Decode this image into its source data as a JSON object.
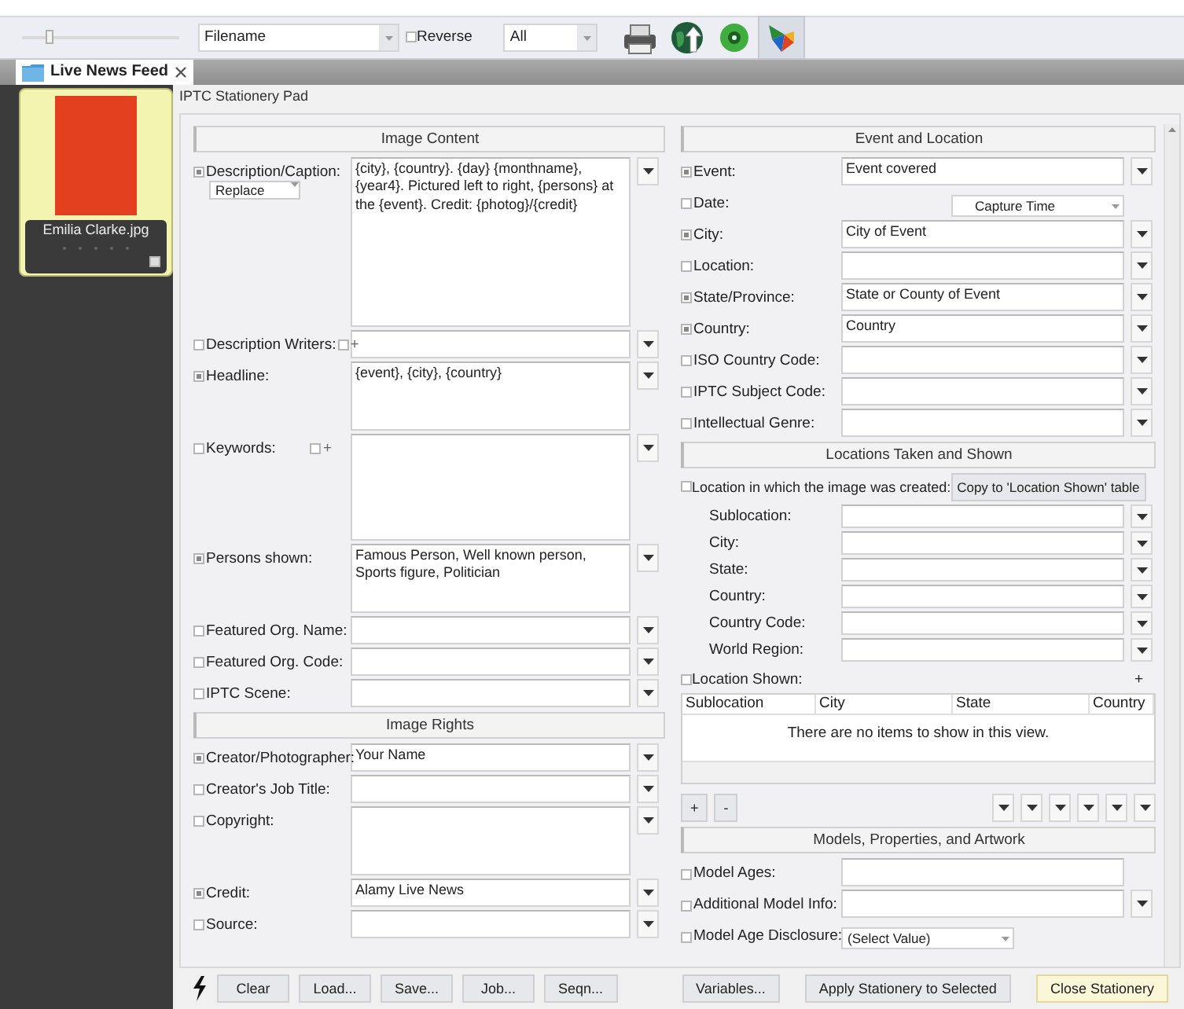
{
  "toolbar": {
    "zoom_slider": {
      "level": 0.15
    },
    "sort_field": {
      "value": "Filename"
    },
    "reverse": {
      "label": "Reverse",
      "checked": false
    },
    "filter": {
      "value": "All"
    },
    "tools": [
      {
        "kind": "printer",
        "selected": false
      },
      {
        "kind": "globe",
        "selected": false
      },
      {
        "kind": "disc",
        "selected": false
      },
      {
        "kind": "logo",
        "selected": true
      }
    ]
  },
  "tabs": [
    {
      "label": "Live News Feed",
      "selected": true
    }
  ],
  "thumbnails": [
    {
      "filename": "Emilia Clarke.jpg",
      "selected": true,
      "checked": false
    }
  ],
  "panel_title": "IPTC Stationery Pad",
  "left_sections": [
    {
      "title": "Image Content",
      "fields": [
        {
          "label": "Description/Caption:",
          "checked": true,
          "kind": "caption",
          "mode": "Replace",
          "value": "{city}, {country}. {day} {monthname}, {year4}. Pictured left to right, {persons} at the {event}. Credit: {photog}/{credit}",
          "menu": true
        },
        {
          "label": "Description Writers:",
          "checked": false,
          "kind": "text",
          "adder": {
            "label": "+",
            "checked": false
          },
          "menu": true
        },
        {
          "label": "Headline:",
          "checked": true,
          "kind": "memo",
          "value": "{event}, {city}, {country}",
          "menu": true
        },
        {
          "label": "Keywords:",
          "checked": false,
          "kind": "tall-memo",
          "adder": {
            "label": "+",
            "checked": false
          },
          "menu": true
        },
        {
          "label": "Persons shown:",
          "checked": true,
          "kind": "memo",
          "value": "Famous Person, Well known person, Sports figure, Politician",
          "menu": true
        },
        {
          "label": "Featured Org. Name:",
          "checked": false,
          "kind": "text",
          "menu": true
        },
        {
          "label": "Featured Org. Code:",
          "checked": false,
          "kind": "text",
          "menu": true
        },
        {
          "label": "IPTC Scene:",
          "checked": false,
          "kind": "text",
          "menu": true
        }
      ]
    },
    {
      "title": "Image Rights",
      "fields": [
        {
          "label": "Creator/Photographer:",
          "checked": true,
          "kind": "text",
          "value": "Your Name",
          "menu": true
        },
        {
          "label": "Creator's Job Title:",
          "checked": false,
          "kind": "text",
          "menu": true
        },
        {
          "label": "Copyright:",
          "checked": false,
          "kind": "memo",
          "menu": true
        },
        {
          "label": "Credit:",
          "checked": true,
          "kind": "text",
          "value": "Alamy Live News",
          "menu": true
        },
        {
          "label": "Source:",
          "checked": false,
          "kind": "text",
          "menu": true
        }
      ]
    }
  ],
  "right_sections": [
    {
      "title": "Event and Location",
      "fields": [
        {
          "label": "Event:",
          "checked": true,
          "kind": "text",
          "value": "Event covered",
          "menu": true
        },
        {
          "label": "Date:",
          "checked": false,
          "kind": "select",
          "value": "Capture Time",
          "menu": false
        },
        {
          "label": "City:",
          "checked": true,
          "kind": "text",
          "value": "City of Event",
          "menu": true
        },
        {
          "label": "Location:",
          "checked": false,
          "kind": "text",
          "menu": true
        },
        {
          "label": "State/Province:",
          "checked": true,
          "kind": "text",
          "value": "State or County of Event",
          "menu": true
        },
        {
          "label": "Country:",
          "checked": true,
          "kind": "text",
          "value": "Country",
          "menu": true
        },
        {
          "label": "ISO Country Code:",
          "checked": false,
          "kind": "text",
          "menu": true
        },
        {
          "label": "IPTC Subject Code:",
          "checked": false,
          "kind": "text",
          "menu": true
        },
        {
          "label": "Intellectual Genre:",
          "checked": false,
          "kind": "text",
          "menu": true
        }
      ]
    },
    {
      "title": "Locations Taken and Shown",
      "location_created": {
        "label": "Location in which the image was created:",
        "checked": false,
        "button": "Copy to 'Location Shown' table",
        "fields": [
          {
            "label": "Sublocation:",
            "menu": true
          },
          {
            "label": "City:",
            "menu": true
          },
          {
            "label": "State:",
            "menu": true
          },
          {
            "label": "Country:",
            "menu": true
          },
          {
            "label": "Country Code:",
            "menu": true
          },
          {
            "label": "World Region:",
            "menu": true
          }
        ]
      },
      "location_shown": {
        "label": "Location Shown:",
        "checked": false,
        "add": "+",
        "columns": [
          "Sublocation",
          "City",
          "State",
          "Country"
        ],
        "empty_text": "There are no items to show in this view.",
        "row_buttons": [
          "+",
          "-"
        ]
      }
    },
    {
      "title": "Models, Properties, and Artwork",
      "fields": [
        {
          "label": "Model Ages:",
          "checked": false,
          "kind": "text",
          "menu": false
        },
        {
          "label": "Additional Model Info:",
          "checked": false,
          "kind": "text",
          "menu": true
        },
        {
          "label": "Model Age Disclosure:",
          "checked": false,
          "kind": "select",
          "value": "(Select Value)",
          "menu": false
        }
      ]
    }
  ],
  "footer_left": [
    {
      "label": "Clear",
      "highlighted": false
    },
    {
      "label": "Load...",
      "highlighted": false
    },
    {
      "label": "Save...",
      "highlighted": false
    },
    {
      "label": "Job...",
      "highlighted": false
    },
    {
      "label": "Seqn...",
      "highlighted": false
    }
  ],
  "footer_right": [
    {
      "label": "Variables...",
      "highlighted": false
    },
    {
      "label": "Apply Stationery to Selected",
      "highlighted": false
    },
    {
      "label": "Close Stationery",
      "highlighted": true
    }
  ]
}
